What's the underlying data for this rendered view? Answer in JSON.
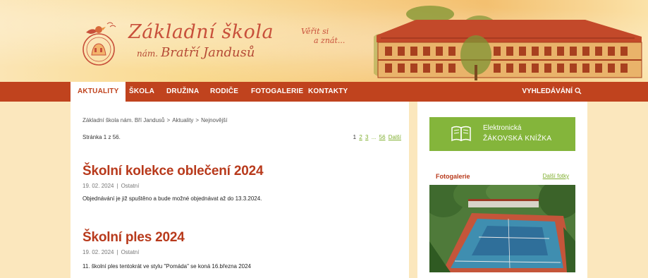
{
  "header": {
    "logo_line1": "Základní škola",
    "logo_line2_small": "nám.",
    "logo_line2": "Bratří Jandusů",
    "motto_line1": "Věřit si",
    "motto_line2": "a znát..."
  },
  "nav": {
    "items": [
      {
        "label": "AKTUALITY"
      },
      {
        "label": "ŠKOLA"
      },
      {
        "label": "DRUŽINA"
      },
      {
        "label": "RODIČE"
      },
      {
        "label": "FOTOGALERIE"
      },
      {
        "label": "KONTAKTY"
      }
    ],
    "search_label": "VYHLEDÁVÁNÍ"
  },
  "breadcrumb": {
    "items": [
      "Základní škola nám. Bří Jandusů",
      "Aktuality",
      "Nejnovější"
    ],
    "separator": ">"
  },
  "pagination": {
    "page_info": "Stránka 1 z 56.",
    "current": "1",
    "pages": [
      "2",
      "3"
    ],
    "ellipsis": "...",
    "last": "56",
    "next": "Další"
  },
  "articles": [
    {
      "title": "Školní kolekce oblečení 2024",
      "date": "19. 02. 2024",
      "category": "Ostatní",
      "excerpt": "Objednávání je již spuštěno a bude možné objednávat až do 13.3.2024."
    },
    {
      "title": "Školní ples 2024",
      "date": "19. 02. 2024",
      "category": "Ostatní",
      "excerpt": "11. školní ples tentokrát ve stylu \"Pomáda\" se koná 16.března 2024"
    }
  ],
  "sidebar": {
    "ezk_line1": "Elektronická",
    "ezk_line2": "ŽÁKOVSKÁ KNÍŽKA",
    "gallery_title": "Fotogalerie",
    "gallery_more": "Další fotky"
  },
  "colors": {
    "brand_red": "#c0431e",
    "title_red": "#b83a1c",
    "link_green": "#7fae2e",
    "ezk_green": "#84b53b",
    "page_bg": "#fbe7bd"
  },
  "icons": {
    "search": "search-icon",
    "book": "book-icon",
    "bird_logo": "logo-emblem-icon"
  }
}
